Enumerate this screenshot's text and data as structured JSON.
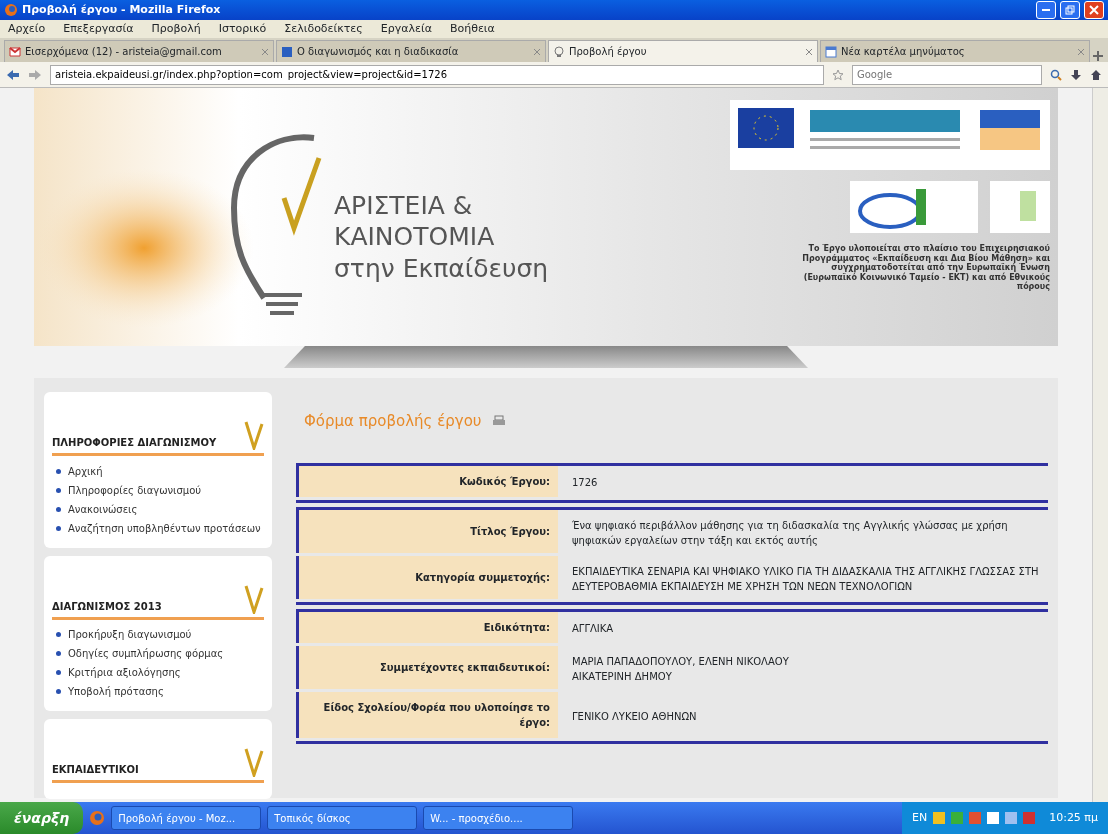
{
  "window": {
    "title": "Προβολή έργου - Mozilla Firefox"
  },
  "menu": [
    "Αρχείο",
    "Επεξεργασία",
    "Προβολή",
    "Ιστορικό",
    "Σελιδοδείκτες",
    "Εργαλεία",
    "Βοήθεια"
  ],
  "tabs": [
    {
      "label": "Εισερχόμενα (12) - aristeia@gmail.com",
      "kind": "mail",
      "selected": false
    },
    {
      "label": "Ο διαγωνισμός και η διαδικασία",
      "kind": "doc",
      "selected": false
    },
    {
      "label": "Προβολή έργου",
      "kind": "bulb",
      "selected": true
    },
    {
      "label": "Νέα καρτέλα μηνύματος",
      "kind": "page",
      "selected": false
    }
  ],
  "address": {
    "value": "aristeia.ekpaideusi.gr/index.php?option=com_project&view=project&id=1726"
  },
  "search": {
    "placeholder": "Google"
  },
  "site": {
    "title_lines": [
      "ΑΡΙΣΤΕΙΑ &",
      "ΚΑΙΝΟΤΟΜΙΑ",
      "στην Εκπαίδευση"
    ],
    "funding_note": "Το Έργο υλοποιείται στο πλαίσιο του Επιχειρησιακού Προγράμματος «Εκπαίδευση και Δια Βίου Μάθηση» και συγχρηματοδοτείται από την Ευρωπαϊκή Ένωση (Ευρωπαϊκό Κοινωνικό Ταμείο - ΕΚΤ) και από Εθνικούς πόρους"
  },
  "sidebar": [
    {
      "title": "ΠΛΗΡΟΦΟΡΙΕΣ ΔΙΑΓΩΝΙΣΜΟΥ",
      "items": [
        "Αρχική",
        "Πληροφορίες διαγωνισμού",
        "Ανακοινώσεις",
        "Αναζήτηση υποβληθέντων προτάσεων"
      ]
    },
    {
      "title": "ΔΙΑΓΩΝΙΣΜΟΣ 2013",
      "items": [
        "Προκήρυξη διαγωνισμού",
        "Οδηγίες συμπλήρωσης φόρμας",
        "Κριτήρια αξιολόγησης",
        "Υποβολή πρότασης"
      ]
    },
    {
      "title": "ΕΚΠΑΙΔΕΥΤΙΚΟΙ"
    }
  ],
  "main": {
    "heading": "Φόρμα προβολής έργου",
    "groups": [
      {
        "rows": [
          {
            "label": "Κωδικός Έργου:",
            "value": "1726"
          }
        ]
      },
      {
        "rows": [
          {
            "label": "Τίτλος Έργου:",
            "value": "Ένα ψηφιακό περιβάλλον μάθησης για τη διδασκαλία της Αγγλικής γλώσσας με χρήση ψηφιακών εργαλείων στην τάξη και εκτός αυτής"
          },
          {
            "label": "Κατηγορία συμμετοχής:",
            "value": "ΕΚΠΑΙΔΕΥΤΙΚΑ ΣΕΝΑΡΙΑ ΚΑΙ ΨΗΦΙΑΚΟ ΥΛΙΚΟ ΓΙΑ ΤΗ ΔΙΔΑΣΚΑΛΙΑ ΤΗΣ ΑΓΓΛΙΚΗΣ ΓΛΩΣΣΑΣ ΣΤΗ ΔΕΥΤΕΡΟΒΑΘΜΙΑ ΕΚΠΑΙΔΕΥΣΗ ΜΕ ΧΡΗΣΗ ΤΩΝ ΝΕΩΝ ΤΕΧΝΟΛΟΓΙΩΝ"
          }
        ]
      },
      {
        "rows": [
          {
            "label": "Ειδικότητα:",
            "value": "ΑΓΓΛΙΚΑ"
          },
          {
            "label": "Συμμετέχοντες εκπαιδευτικοί:",
            "value": "ΜΑΡΙΑ ΠΑΠΑΔΟΠΟΥΛΟΥ, ΕΛΕΝΗ ΝΙΚΟΛΑΟΥ\nΑΙΚΑΤΕΡΙΝΗ ΔΗΜΟΥ"
          },
          {
            "label": "Είδος Σχολείου/Φορέα που υλοποίησε το έργο:",
            "value": "ΓΕΝΙΚΟ ΛΥΚΕΙΟ ΑΘΗΝΩΝ"
          }
        ]
      }
    ]
  },
  "taskbar": {
    "start": "έναρξη",
    "tasks": [
      "Προβολή έργου - Moz...",
      "Τοπικός δίσκος",
      "W... - προσχέδιο...."
    ],
    "language": "EN",
    "clock": "10:25 πμ"
  }
}
